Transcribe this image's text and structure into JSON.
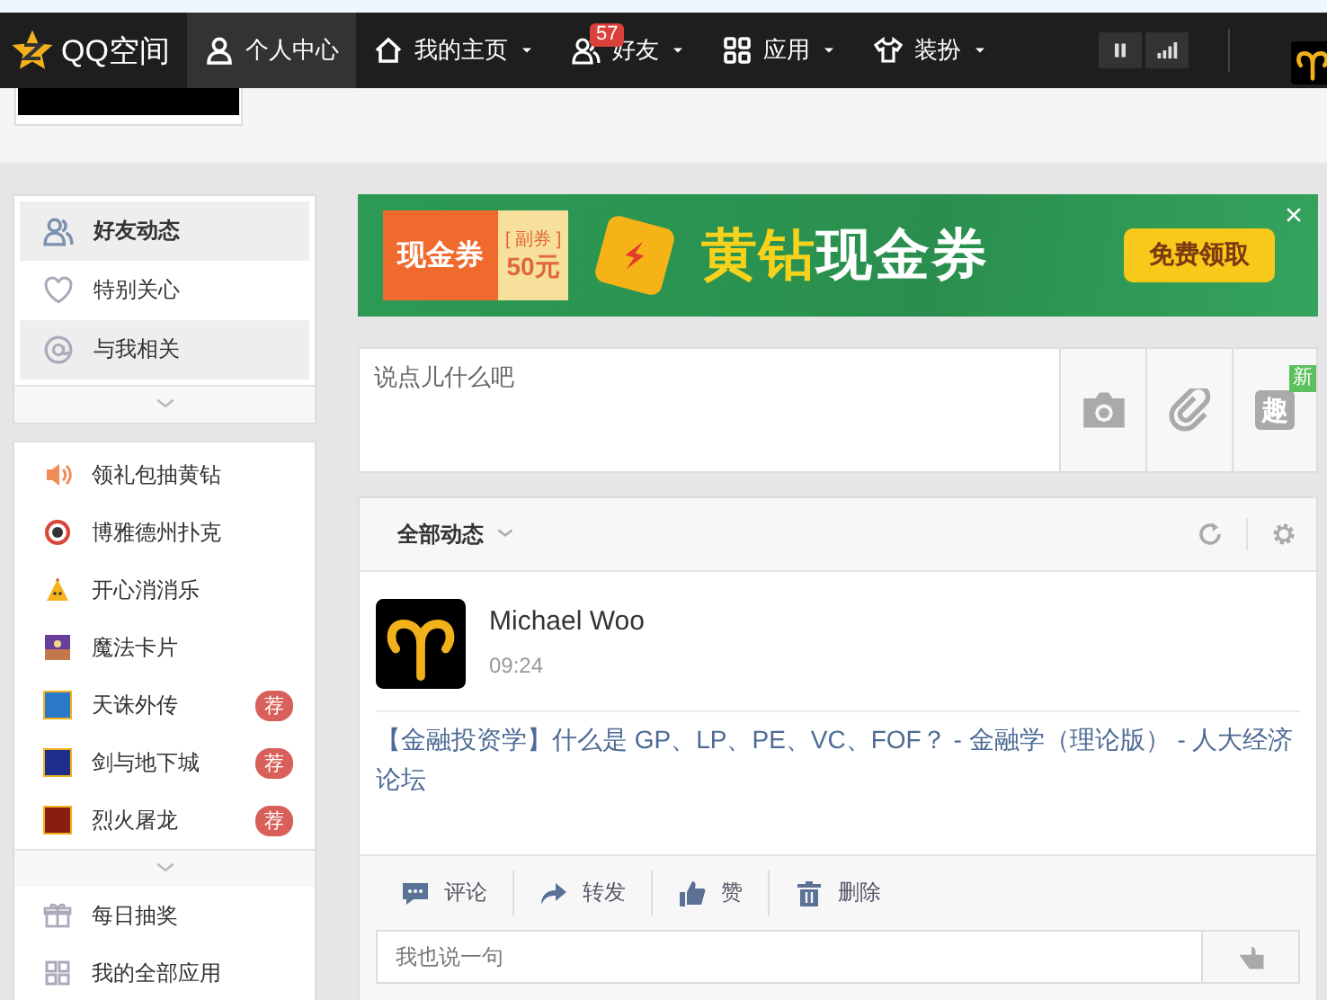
{
  "nav": {
    "logo": "QQ空间",
    "items": [
      {
        "label": "个人中心",
        "selected": true,
        "dropdown": false
      },
      {
        "label": "我的主页",
        "selected": false,
        "dropdown": true
      },
      {
        "label": "好友",
        "selected": false,
        "dropdown": true,
        "badge": "57"
      },
      {
        "label": "应用",
        "selected": false,
        "dropdown": true
      },
      {
        "label": "装扮",
        "selected": false,
        "dropdown": true
      }
    ]
  },
  "sidebar": {
    "feeds": [
      {
        "label": "好友动态",
        "selected": true,
        "hovered": false
      },
      {
        "label": "特别关心",
        "selected": false,
        "hovered": false
      },
      {
        "label": "与我相关",
        "selected": false,
        "hovered": true
      }
    ],
    "apps": [
      {
        "label": "领礼包抽黄钻"
      },
      {
        "label": "博雅德州扑克"
      },
      {
        "label": "开心消消乐"
      },
      {
        "label": "魔法卡片"
      },
      {
        "label": "天诛外传",
        "badge": "荐",
        "color": "#2a78c8"
      },
      {
        "label": "剑与地下城",
        "badge": "荐",
        "color": "#1d2f8a"
      },
      {
        "label": "烈火屠龙",
        "badge": "荐",
        "color": "#8a1d12"
      }
    ],
    "more": [
      {
        "label": "每日抽奖"
      },
      {
        "label": "我的全部应用"
      }
    ]
  },
  "banner": {
    "coupon": "现金券",
    "sub": "[ 副券 ]",
    "amount": "50元",
    "headline_gold": "黄钻",
    "headline_white": "现金券",
    "button": "免费领取"
  },
  "composer": {
    "placeholder": "说点儿什么吧",
    "fun": "趣",
    "new_badge": "新"
  },
  "feed": {
    "filter": "全部动态",
    "post": {
      "author": "Michael Woo",
      "time": "09:24",
      "text": "【金融投资学】什么是 GP、LP、PE、VC、FOF？ - 金融学（理论版） - 人大经济论坛",
      "actions": [
        {
          "label": "评论",
          "kind": "comment"
        },
        {
          "label": "转发",
          "kind": "share"
        },
        {
          "label": "赞",
          "kind": "like"
        },
        {
          "label": "删除",
          "kind": "delete"
        }
      ],
      "reply_placeholder": "我也说一句"
    }
  }
}
